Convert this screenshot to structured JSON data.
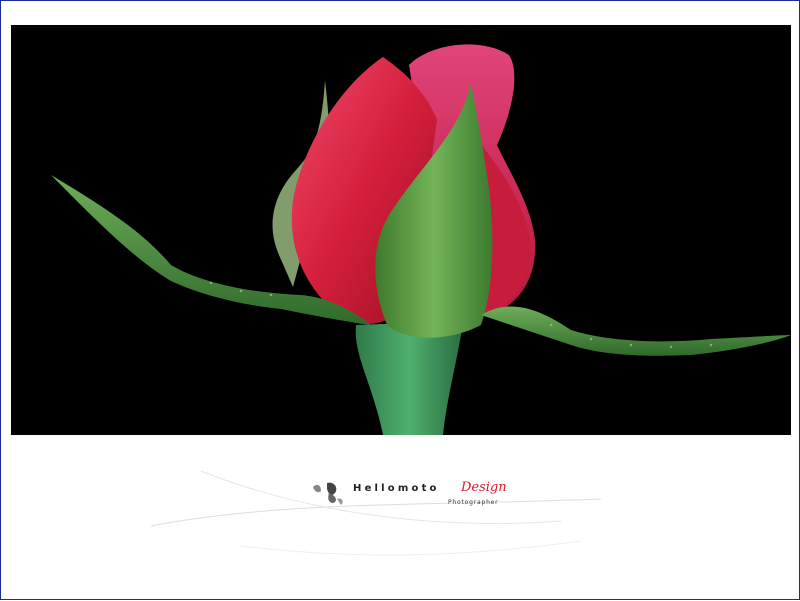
{
  "watermark": {
    "brand": "Hellomoto",
    "design": "Design",
    "photographer": "Photographer"
  },
  "colors": {
    "frame_border": "#1a2a9c",
    "petal": "#e0284a",
    "sepal": "#5ea24c",
    "stem": "#3f9a5c",
    "accent": "#d81a2c"
  }
}
